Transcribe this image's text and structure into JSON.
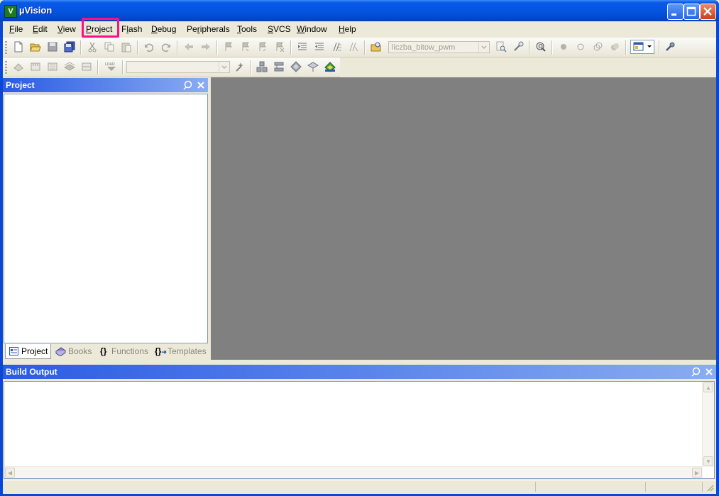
{
  "window": {
    "title": "µVision",
    "app_icon_letter": "V"
  },
  "menubar": {
    "items": [
      {
        "label": "File",
        "accel": "F",
        "rest": "ile"
      },
      {
        "label": "Edit",
        "accel": "E",
        "rest": "dit"
      },
      {
        "label": "View",
        "accel": "V",
        "rest": "iew"
      },
      {
        "label": "Project",
        "accel": "P",
        "rest": "roject"
      },
      {
        "label": "Flash",
        "pre": "F",
        "accel": "l",
        "rest": "ash"
      },
      {
        "label": "Debug",
        "accel": "D",
        "rest": "ebug"
      },
      {
        "label": "Peripherals",
        "pre": "Pe",
        "accel": "r",
        "rest": "ipherals"
      },
      {
        "label": "Tools",
        "accel": "T",
        "rest": "ools"
      },
      {
        "label": "SVCS",
        "accel": "S",
        "rest": "VCS"
      },
      {
        "label": "Window",
        "accel": "W",
        "rest": "indow"
      },
      {
        "label": "Help",
        "accel": "H",
        "rest": "elp"
      }
    ]
  },
  "toolbar": {
    "target_combo": "liczba_bitow_pwm",
    "build_combo": ""
  },
  "project_panel": {
    "title": "Project"
  },
  "tabs": [
    {
      "label": "Project",
      "icon": "project-icon"
    },
    {
      "label": "Books",
      "icon": "books-icon"
    },
    {
      "label": "Functions",
      "icon": "functions-icon"
    },
    {
      "label": "Templates",
      "icon": "templates-icon"
    }
  ],
  "build_output": {
    "title": "Build Output"
  },
  "colors": {
    "highlight": "#ff0f86",
    "titlebar": "#0454e0",
    "mdi_background": "#808080"
  }
}
